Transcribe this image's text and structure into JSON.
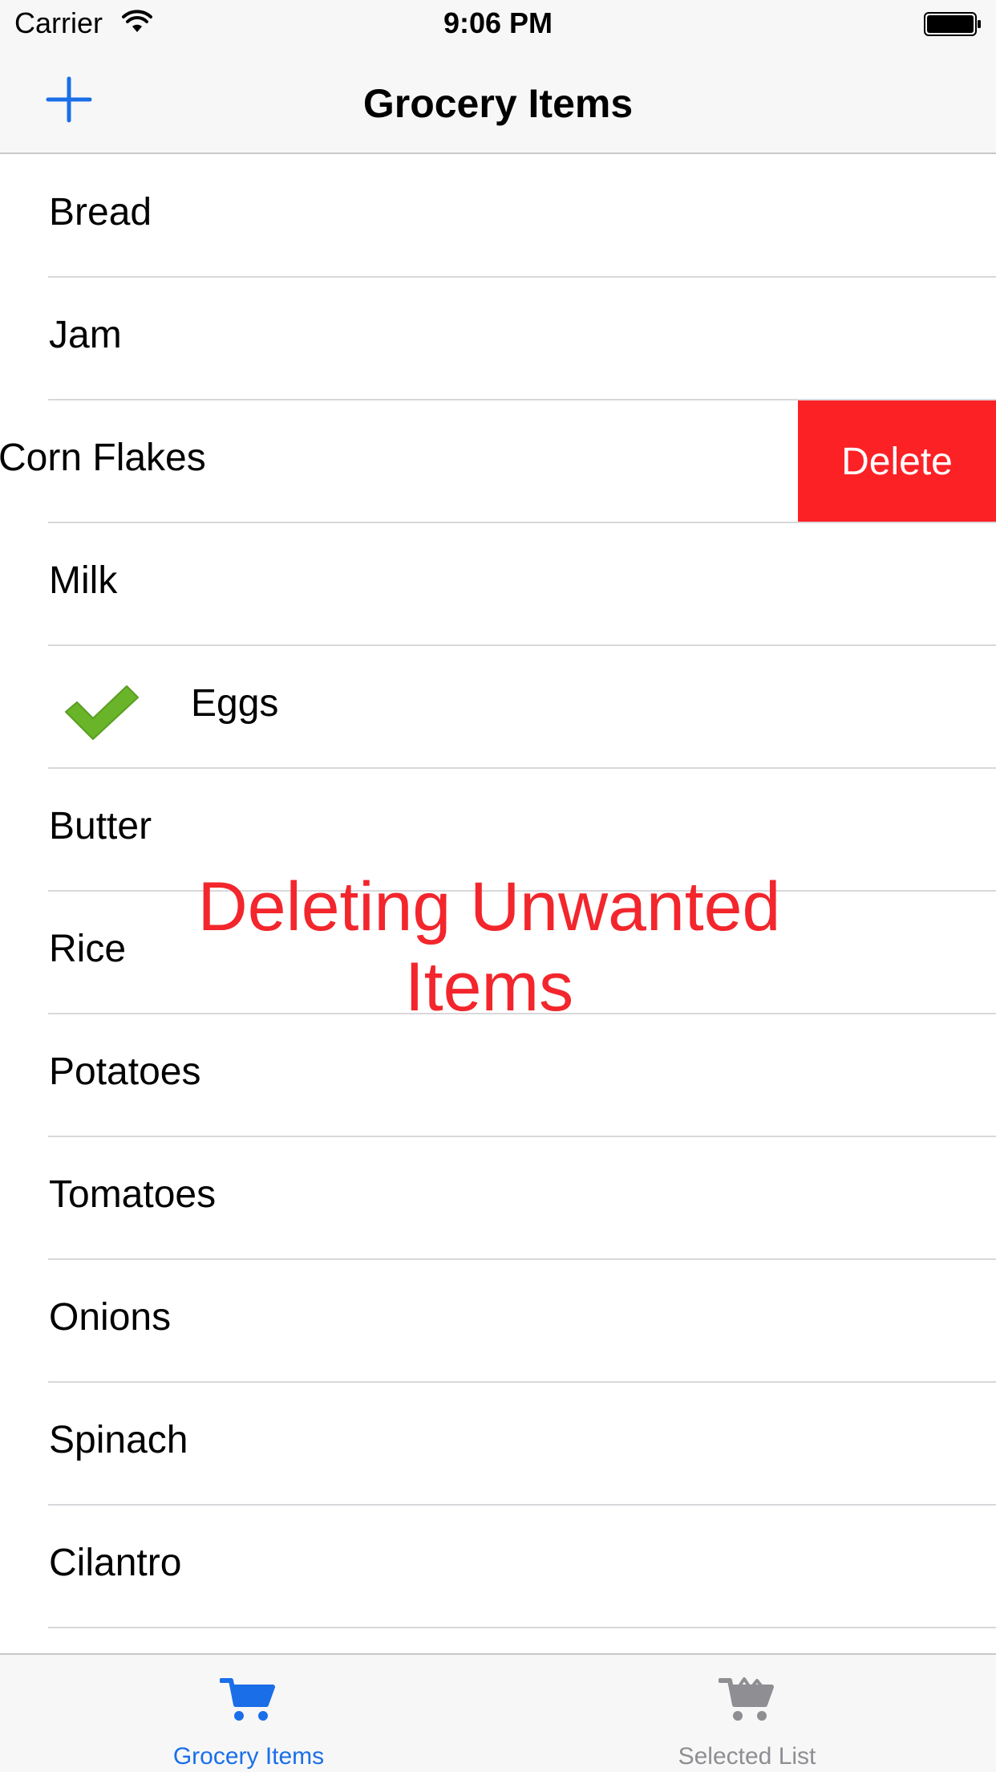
{
  "status_bar": {
    "carrier": "Carrier",
    "time": "9:06 PM"
  },
  "nav_bar": {
    "title": "Grocery Items",
    "add_icon": "plus-icon"
  },
  "items": [
    {
      "label": "Bread"
    },
    {
      "label": "Jam"
    },
    {
      "label": "Corn Flakes"
    },
    {
      "label": "Milk"
    },
    {
      "label": "Eggs"
    },
    {
      "label": "Butter"
    },
    {
      "label": "Rice"
    },
    {
      "label": "Potatoes"
    },
    {
      "label": "Tomatoes"
    },
    {
      "label": "Onions"
    },
    {
      "label": "Spinach"
    },
    {
      "label": "Cilantro"
    }
  ],
  "swiped_row": {
    "item_index": 2,
    "delete_label": "Delete"
  },
  "checked_row": {
    "item_index": 4,
    "icon": "checkmark-icon"
  },
  "caption": {
    "line1": "Deleting Unwanted",
    "line2": "Items"
  },
  "tab_bar": {
    "tabs": [
      {
        "label": "Grocery Items",
        "icon": "cart-icon",
        "selected": true
      },
      {
        "label": "Selected List",
        "icon": "cart-icon",
        "selected": false
      }
    ]
  },
  "colors": {
    "accent": "#1a6fe8",
    "delete": "#fc2125",
    "caption": "#f2262c",
    "check": "#6ab42a",
    "inactive_tab": "#8e8e93"
  }
}
